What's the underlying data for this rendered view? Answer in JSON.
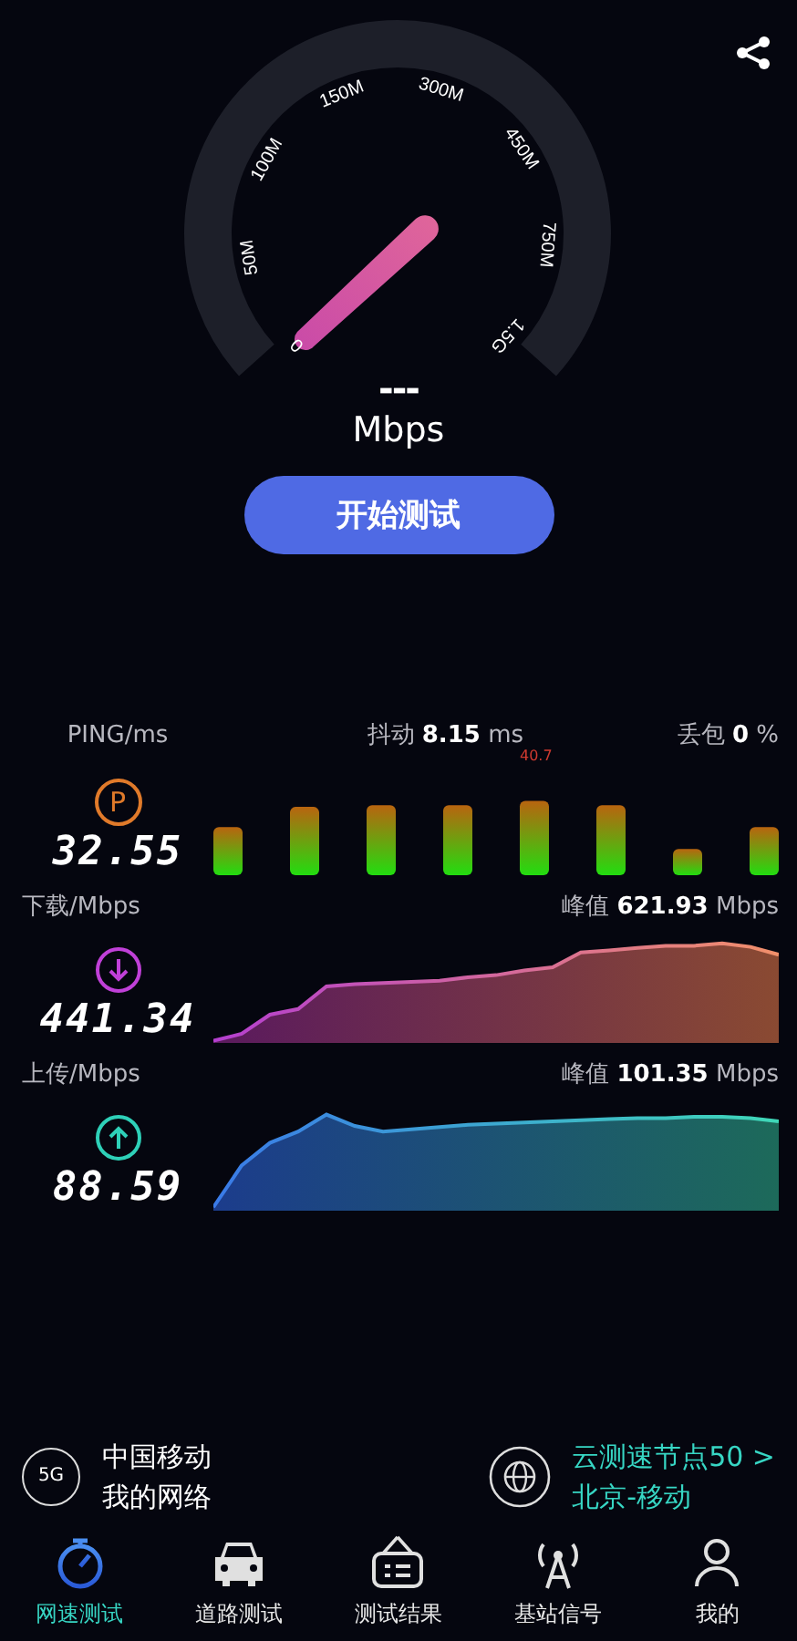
{
  "gauge": {
    "scale_labels": [
      "0",
      "50M",
      "100M",
      "150M",
      "300M",
      "450M",
      "750M",
      "1.5G"
    ],
    "value": "---",
    "unit": "Mbps"
  },
  "start_button": "开始测试",
  "ping": {
    "label": "PING/ms",
    "jitter": "抖动 **8.15** ms",
    "loss": "丢包 **0** %",
    "icon_letter": "P",
    "value": "32.55",
    "peak_label": "40.7"
  },
  "download": {
    "label": "下载/Mbps",
    "peak": "峰值 **621.93** Mbps",
    "value": "441.34"
  },
  "upload": {
    "label": "上传/Mbps",
    "peak": "峰值 **101.35** Mbps",
    "value": "88.59"
  },
  "network": {
    "badge": "5G",
    "carrier": "中国移动",
    "subtitle": "我的网络"
  },
  "server": {
    "title": "云测速节点50 >",
    "location": "北京-移动"
  },
  "tabs": [
    {
      "label": "网速测试",
      "selected": true
    },
    {
      "label": "道路测试",
      "selected": false
    },
    {
      "label": "测试结果",
      "selected": false
    },
    {
      "label": "基站信号",
      "selected": false
    },
    {
      "label": "我的",
      "selected": false
    }
  ]
}
